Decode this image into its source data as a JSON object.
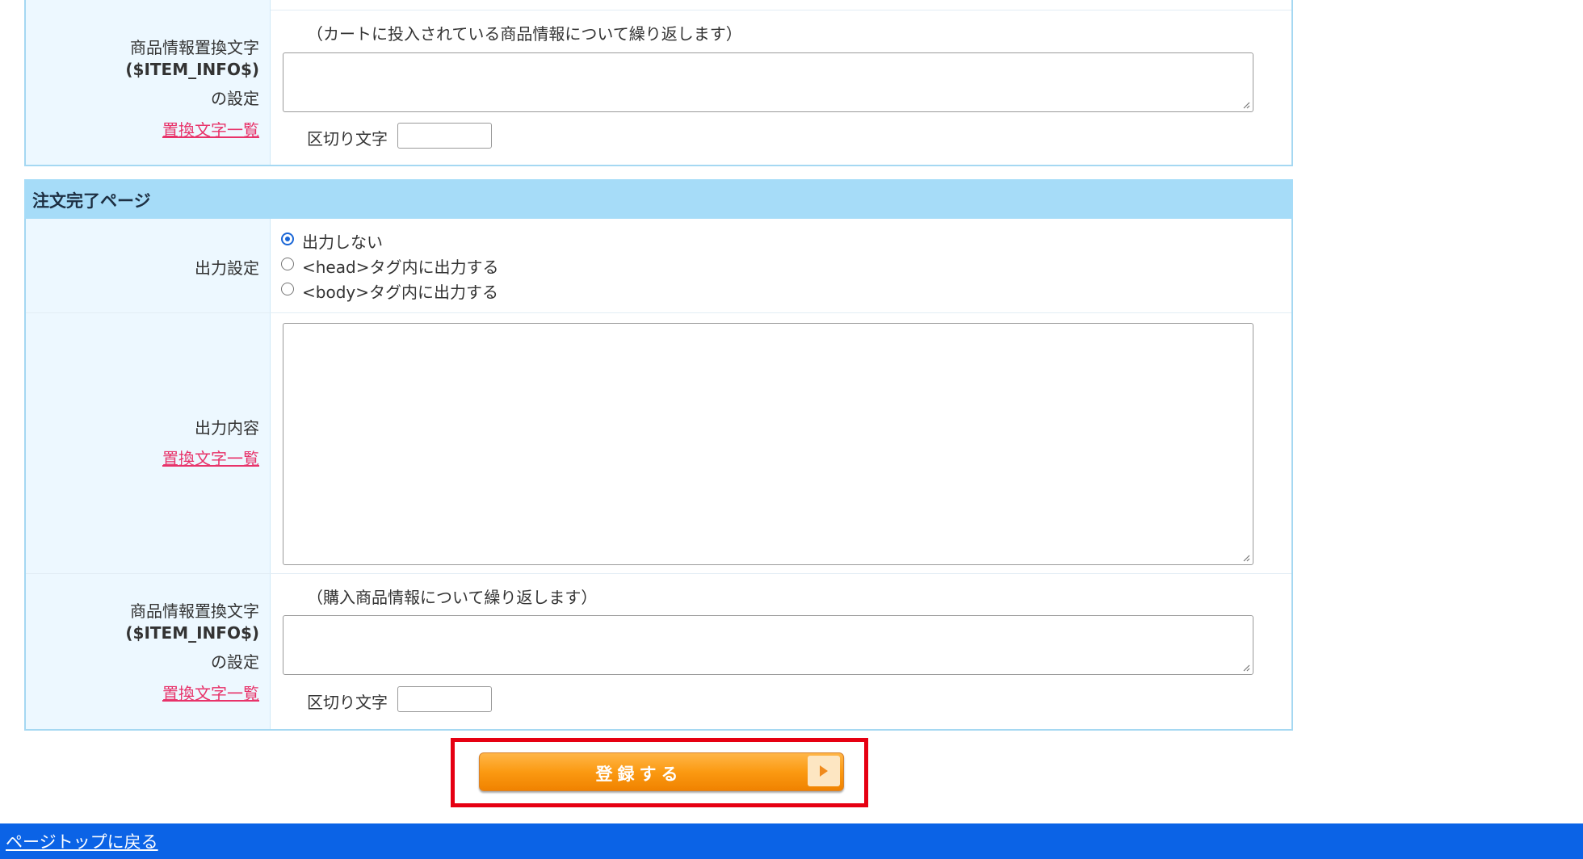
{
  "cart_section": {
    "item_info_label": [
      "商品情報置換文字",
      "($ITEM_INFO$)",
      "の設定"
    ],
    "replace_list_link": "置換文字一覧",
    "note": "（カートに投入されている商品情報について繰り返します）",
    "item_info_value": "",
    "delimiter_label": "区切り文字",
    "delimiter_value": ""
  },
  "order_complete": {
    "title": "注文完了ページ",
    "output_setting": {
      "label": "出力設定",
      "options": [
        {
          "label": "出力しない",
          "selected": true
        },
        {
          "label": "<head>タグ内に出力する",
          "selected": false
        },
        {
          "label": "<body>タグ内に出力する",
          "selected": false
        }
      ]
    },
    "output_content": {
      "label": "出力内容",
      "replace_list_link": "置換文字一覧",
      "value": ""
    },
    "item_info": {
      "label": [
        "商品情報置換文字",
        "($ITEM_INFO$)",
        "の設定"
      ],
      "replace_list_link": "置換文字一覧",
      "note": "（購入商品情報について繰り返します）",
      "value": "",
      "delimiter_label": "区切り文字",
      "delimiter_value": ""
    }
  },
  "submit": {
    "label": "登録する"
  },
  "footer": {
    "page_top_link": "ページトップに戻る"
  },
  "colors": {
    "section_header": "#a6dcf8",
    "label_cell": "#edf8ff",
    "link": "#e8336a",
    "submit_orange": "#fb9a12",
    "highlight": "#e60012",
    "footer": "#0b63e6"
  }
}
